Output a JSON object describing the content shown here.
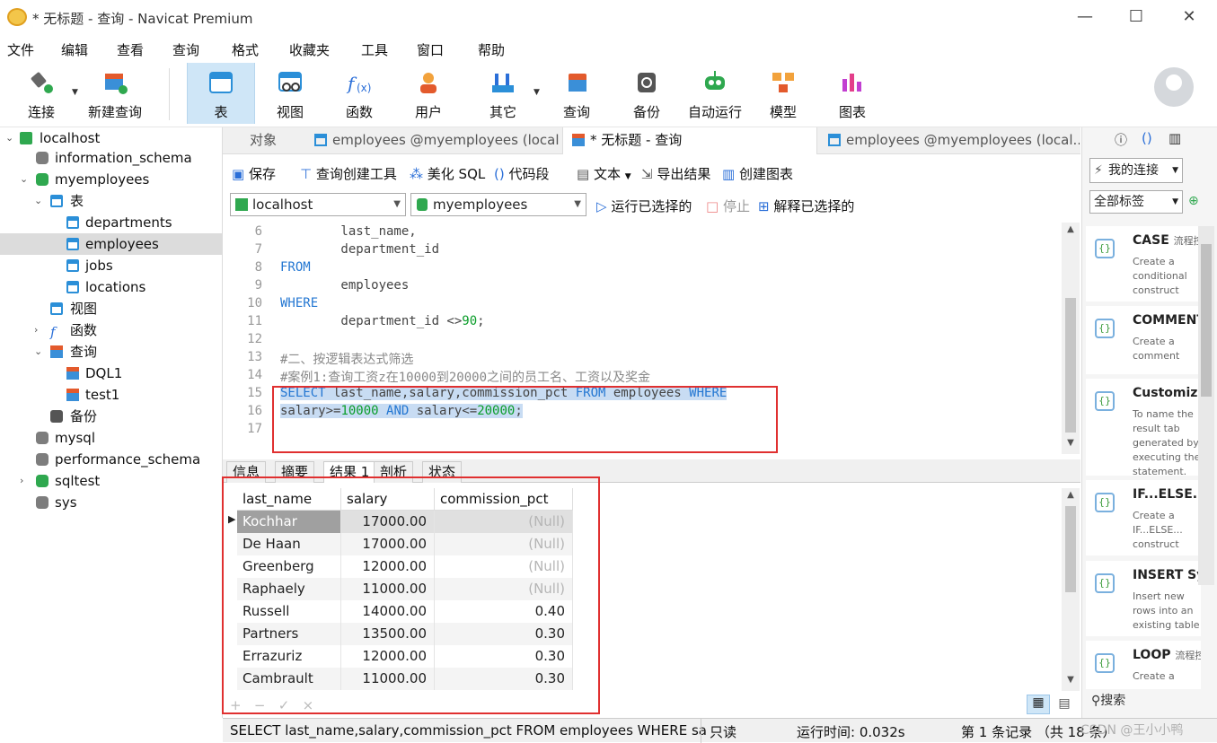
{
  "window": {
    "title": "* 无标题 - 查询 - Navicat Premium"
  },
  "menu": [
    "文件",
    "编辑",
    "查看",
    "查询",
    "格式",
    "收藏夹",
    "工具",
    "窗口",
    "帮助"
  ],
  "toolbar": {
    "connect": "连接",
    "new_query": "新建查询",
    "table": "表",
    "view": "视图",
    "function": "函数",
    "user": "用户",
    "other": "其它",
    "query": "查询",
    "backup": "备份",
    "automation": "自动运行",
    "model": "模型",
    "chart": "图表"
  },
  "tree": {
    "localhost": "localhost",
    "information_schema": "information_schema",
    "myemployees": "myemployees",
    "tables_label": "表",
    "departments": "departments",
    "employees": "employees",
    "jobs": "jobs",
    "locations": "locations",
    "views_label": "视图",
    "functions_label": "函数",
    "queries_label": "查询",
    "dql1": "DQL1",
    "test1": "test1",
    "backup_label": "备份",
    "mysql": "mysql",
    "performance_schema": "performance_schema",
    "sqltest": "sqltest",
    "sys": "sys"
  },
  "tabs": {
    "objects": "对象",
    "tab1": "employees @myemployees (local...",
    "tab2": "* 无标题 - 查询",
    "tab3": "employees @myemployees (local..."
  },
  "query_toolbar": {
    "save": "保存",
    "builder": "查询创建工具",
    "beautify": "美化 SQL",
    "snippet": "代码段",
    "text": "文本",
    "export": "导出结果",
    "create_chart": "创建图表"
  },
  "selectors": {
    "connection": "localhost",
    "database": "myemployees",
    "run_selected": "运行已选择的",
    "stop": "停止",
    "explain": "解释已选择的"
  },
  "editor": {
    "line_numbers": [
      "6",
      "7",
      "8",
      "9",
      "10",
      "11",
      "12",
      "13",
      "14",
      "15",
      "16",
      "17"
    ],
    "l6": "        last_name,",
    "l7": "        department_id",
    "l8": "FROM",
    "l9": "        employees",
    "l10": "WHERE",
    "l11a": "        department_id <>",
    "l11b": "90",
    "l11c": ";",
    "l13": "#二、按逻辑表达式筛选",
    "l14": "#案例1:查询工资z在10000到20000之间的员工名、工资以及奖金",
    "l15a": "SELECT",
    "l15b": " last_name,salary,commission_pct ",
    "l15c": "FROM",
    "l15d": " employees ",
    "l15e": "WHERE",
    "l16a": "salary>=",
    "l16b": "10000",
    "l16c": " ",
    "l16d": "AND",
    "l16e": " salary<=",
    "l16f": "20000",
    "l16g": ";"
  },
  "result_tabs": [
    "信息",
    "摘要",
    "结果 1",
    "剖析",
    "状态"
  ],
  "grid": {
    "headers": [
      "last_name",
      "salary",
      "commission_pct"
    ],
    "rows": [
      [
        "Kochhar",
        "17000.00",
        "(Null)"
      ],
      [
        "De Haan",
        "17000.00",
        "(Null)"
      ],
      [
        "Greenberg",
        "12000.00",
        "(Null)"
      ],
      [
        "Raphaely",
        "11000.00",
        "(Null)"
      ],
      [
        "Russell",
        "14000.00",
        "0.40"
      ],
      [
        "Partners",
        "13500.00",
        "0.30"
      ],
      [
        "Errazuriz",
        "12000.00",
        "0.30"
      ],
      [
        "Cambrault",
        "11000.00",
        "0.30"
      ]
    ]
  },
  "grid_footer": {
    "add": "+",
    "remove": "−",
    "confirm": "✓",
    "cancel": "×"
  },
  "status": {
    "sql": "SELECT last_name,salary,commission_pct FROM employees WHERE salar",
    "readonly": "只读",
    "runtime": "运行时间: 0.032s",
    "records": "第 1 条记录 （共 18 条）",
    "watermark": "CSDN @王小小鸭"
  },
  "right_panel": {
    "my_connections": "我的连接",
    "all_tags": "全部标签",
    "search": "搜索",
    "snippets": [
      {
        "name": "CASE",
        "tag": "流程控",
        "desc": "Create a conditional construct"
      },
      {
        "name": "COMMENT",
        "tag": "",
        "desc": "Create a comment"
      },
      {
        "name": "Customize",
        "tag": "",
        "desc": "To name the result tab generated by executing the statement."
      },
      {
        "name": "IF...ELSE...",
        "tag": "",
        "desc": "Create a IF...ELSE... construct"
      },
      {
        "name": "INSERT Sy",
        "tag": "",
        "desc": "Insert new rows into an existing table"
      },
      {
        "name": "LOOP",
        "tag": "流程控",
        "desc": "Create a"
      }
    ]
  },
  "colors": {
    "accent": "#2b8fd8",
    "highlight": "#e03030",
    "selection": "#c8dcf3"
  }
}
